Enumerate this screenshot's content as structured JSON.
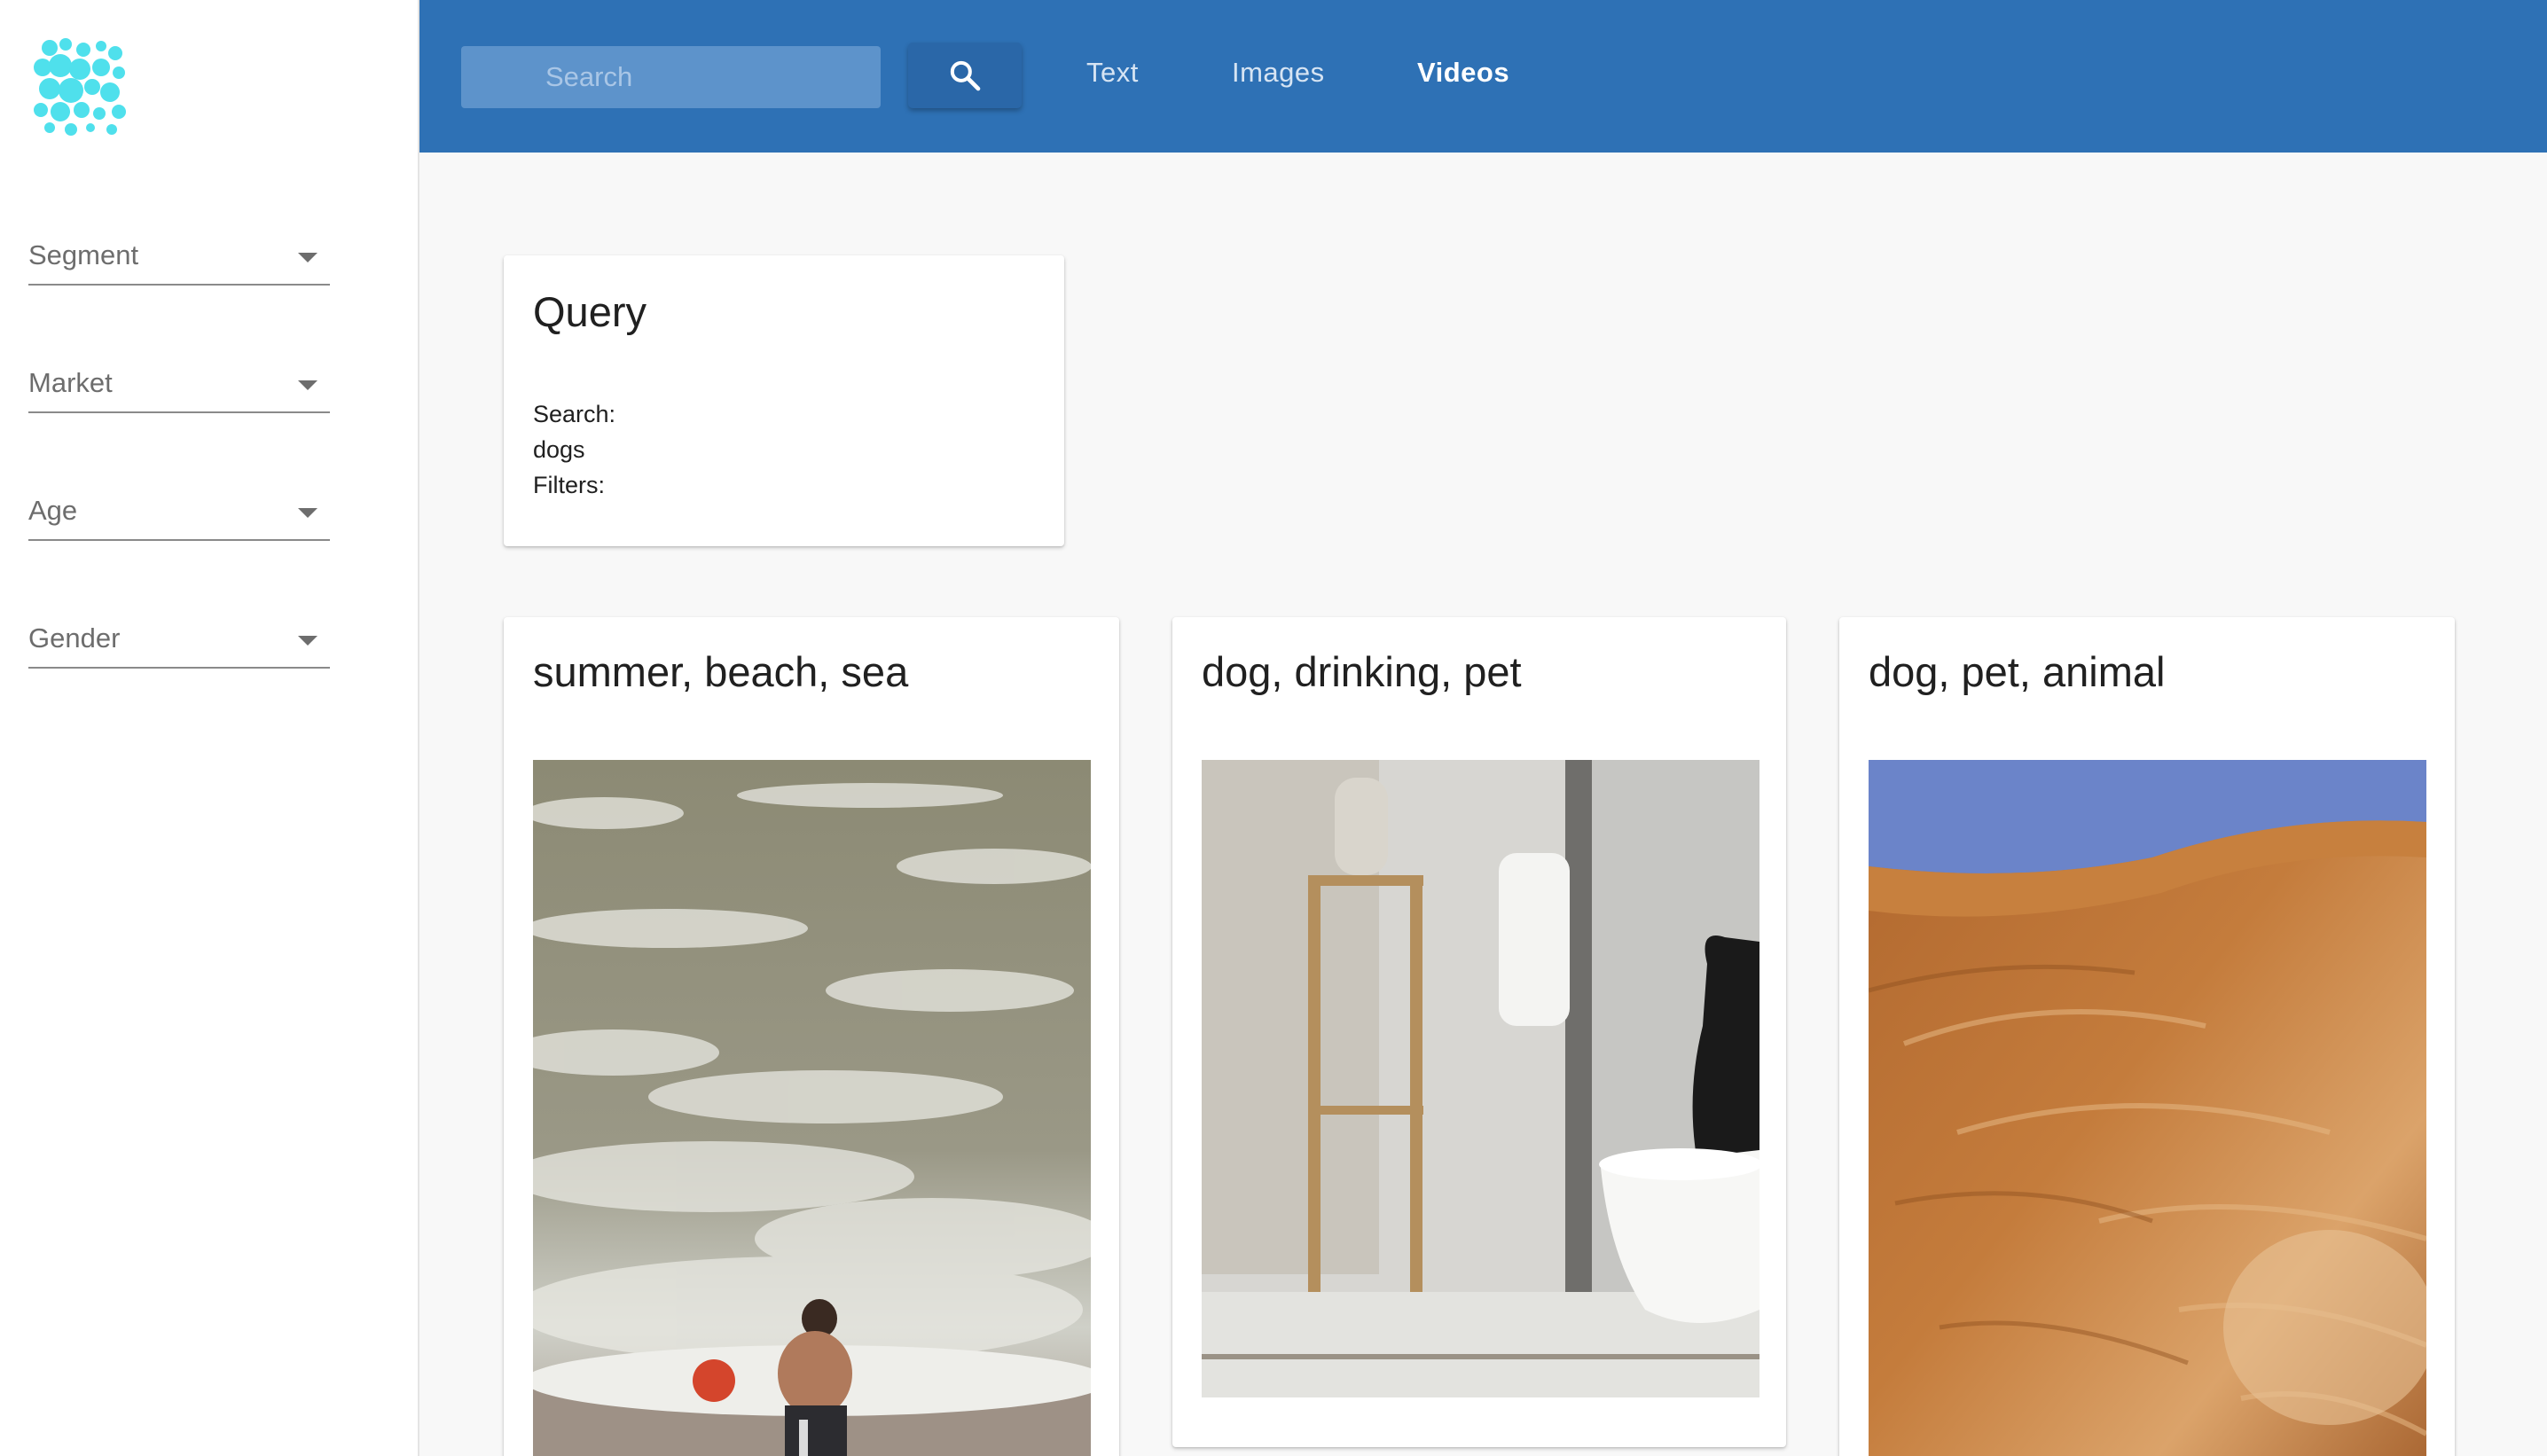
{
  "sidebar": {
    "logo_icon": "blob-logo-icon",
    "filters": [
      {
        "label": "Segment"
      },
      {
        "label": "Market"
      },
      {
        "label": "Age"
      },
      {
        "label": "Gender"
      }
    ]
  },
  "topbar": {
    "search_placeholder": "Search",
    "search_icon": "search-icon",
    "tabs": [
      {
        "label": "Text",
        "active": false
      },
      {
        "label": "Images",
        "active": false
      },
      {
        "label": "Videos",
        "active": true
      }
    ]
  },
  "query_card": {
    "title": "Query",
    "search_label": "Search:",
    "search_value": "dogs",
    "filters_label": "Filters:"
  },
  "results": [
    {
      "title": "summer, beach, sea",
      "thumbnail": "boy with ball in sea surf"
    },
    {
      "title": "dog, drinking, pet",
      "thumbnail": "dog near water bowl"
    },
    {
      "title": "dog, pet, animal",
      "thumbnail": "golden dog fur close-up"
    }
  ],
  "colors": {
    "topbar": "#2e71b5",
    "logo": "#4fe0ec",
    "background": "#f8f8f8"
  }
}
